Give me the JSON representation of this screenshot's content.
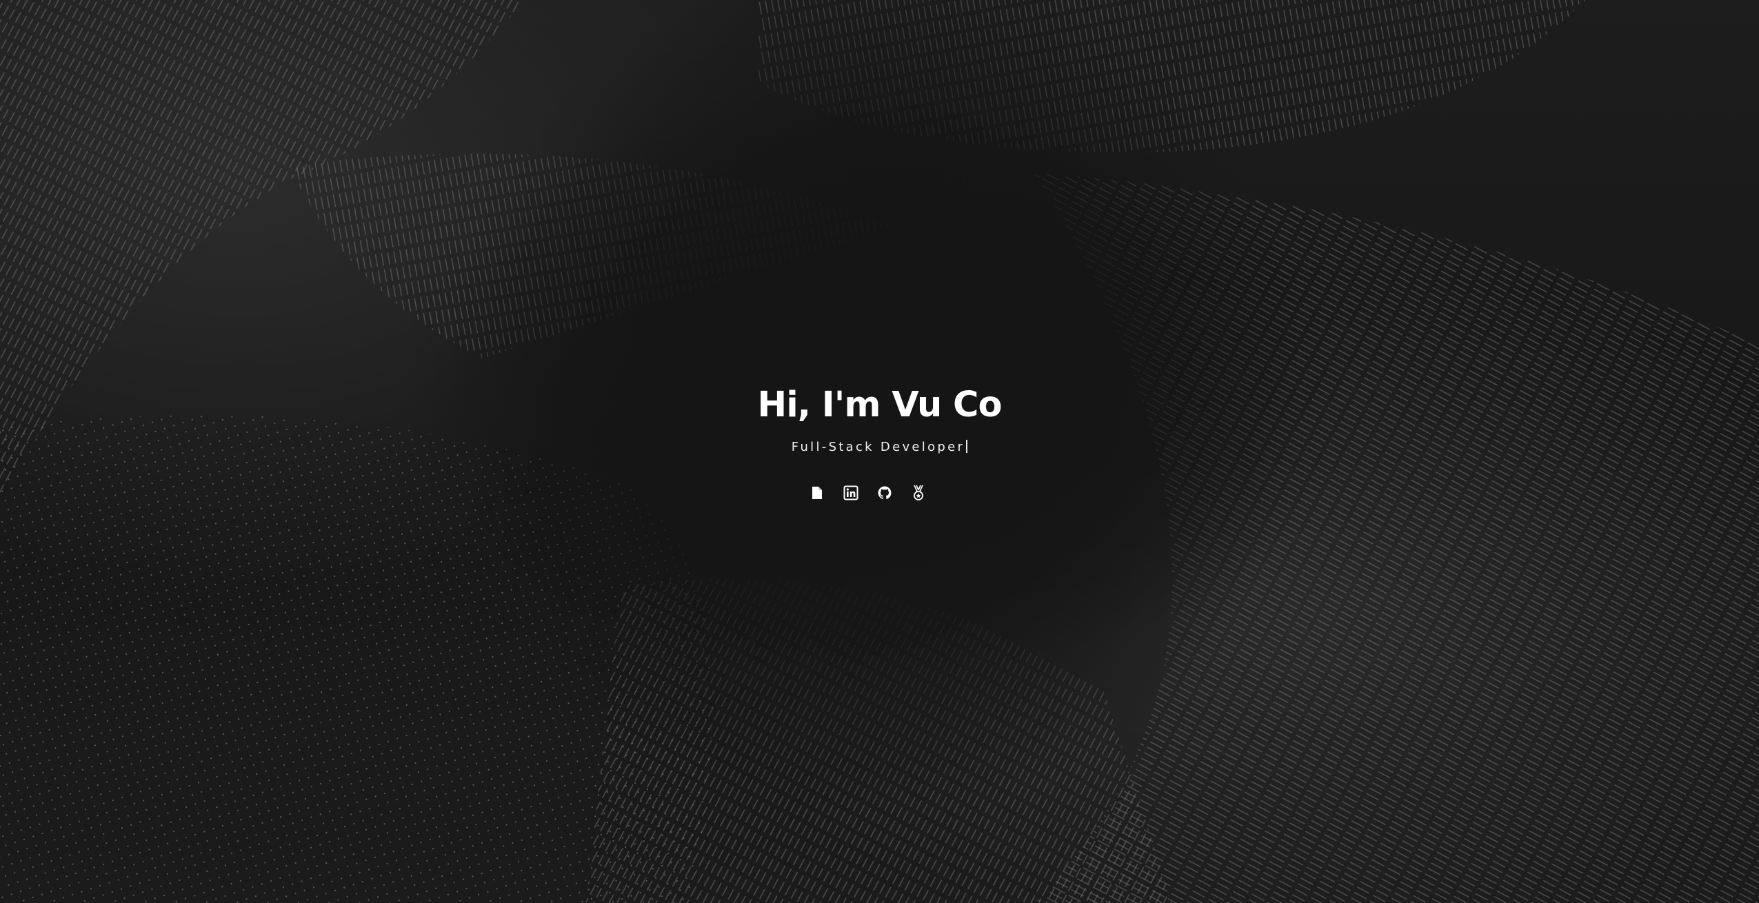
{
  "hero": {
    "title": "Hi, I'm Vu Co",
    "subtitle": "Full-Stack Developer"
  },
  "social_links": [
    {
      "icon": "resume-document-icon"
    },
    {
      "icon": "linkedin-icon"
    },
    {
      "icon": "github-icon"
    },
    {
      "icon": "medal-icon"
    }
  ],
  "colors": {
    "background": "#151515",
    "text": "#ffffff",
    "pattern": "#9a9a9a"
  }
}
